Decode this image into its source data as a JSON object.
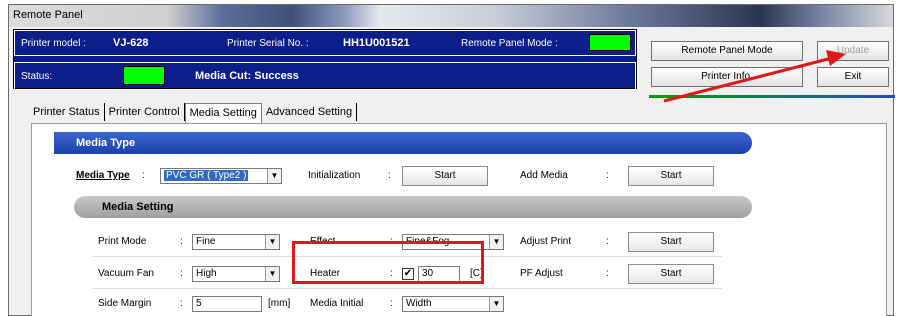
{
  "window": {
    "title": "Remote Panel"
  },
  "info": {
    "printer_model_label": "Printer model :",
    "printer_model_value": "VJ-628",
    "serial_label": "Printer Serial No. :",
    "serial_value": "HH1U001521",
    "remote_mode_label": "Remote Panel Mode :",
    "status_label": "Status:",
    "status_value": "Media Cut: Success",
    "indicator_color": "#00ff00"
  },
  "buttons": {
    "remote_panel_mode": "Remote Panel Mode",
    "update": "Update",
    "printer_info": "Printer Info.",
    "exit": "Exit"
  },
  "tabs": [
    {
      "label": "Printer Status",
      "active": false
    },
    {
      "label": "Printer Control",
      "active": false
    },
    {
      "label": "Media Setting",
      "active": true
    },
    {
      "label": "Advanced Setting",
      "active": false
    }
  ],
  "media_type_section": {
    "header": "Media Type",
    "media_type_label": "Media Type",
    "media_type_value": "PVC GR ( Type2 )",
    "initialization_label": "Initialization",
    "initialization_button": "Start",
    "add_media_label": "Add Media",
    "add_media_button": "Start"
  },
  "media_setting_section": {
    "header": "Media Setting",
    "print_mode_label": "Print Mode",
    "print_mode_value": "Fine",
    "effect_label": "Effect",
    "effect_value": "Fine&Fog",
    "adjust_print_label": "Adjust Print",
    "adjust_print_button": "Start",
    "vacuum_fan_label": "Vacuum Fan",
    "vacuum_fan_value": "High",
    "heater_label": "Heater",
    "heater_checked": true,
    "heater_value": "30",
    "heater_unit": "[C]",
    "pf_adjust_label": "PF Adjust",
    "pf_adjust_button": "Start",
    "side_margin_label": "Side Margin",
    "side_margin_value": "5",
    "side_margin_unit": "[mm]",
    "media_initial_label": "Media Initial",
    "media_initial_value": "Width"
  },
  "colon": ":",
  "annotation_color": "#e11818"
}
